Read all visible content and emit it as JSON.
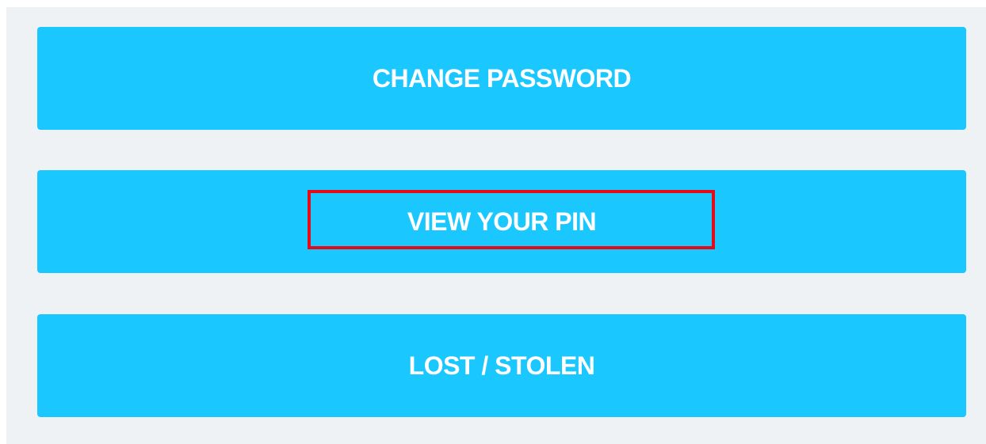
{
  "actions": {
    "change_password": "CHANGE PASSWORD",
    "view_pin": "VIEW YOUR PIN",
    "lost_stolen": "LOST / STOLEN"
  },
  "colors": {
    "panel_background": "#eff2f5",
    "button_background": "#1bc7ff",
    "button_text": "#ffffff",
    "highlight_border": "#e30b17"
  }
}
